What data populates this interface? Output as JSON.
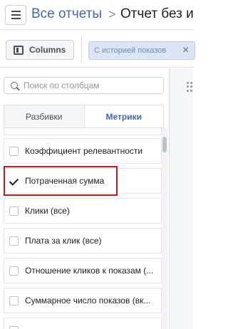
{
  "header": {
    "breadcrumb_link": "Все отчеты",
    "separator": ">",
    "current": "Отчет без и"
  },
  "toolbar": {
    "columns_label": "Columns",
    "filter_chip": "С историей показов",
    "filter_close": "×"
  },
  "panel": {
    "search_placeholder": "Поиск по столбцам",
    "tabs": [
      {
        "label": "Разбивки",
        "active": false
      },
      {
        "label": "Метрики",
        "active": true
      }
    ],
    "items": [
      {
        "label": "",
        "checked": false
      },
      {
        "label": "Коэффициент релевантности",
        "checked": false
      },
      {
        "label": "Потраченная сумма",
        "checked": true,
        "highlighted": true
      },
      {
        "label": "Клики (все)",
        "checked": false
      },
      {
        "label": "Плата за клик (все)",
        "checked": false
      },
      {
        "label": "Отношение кликов к показам (...",
        "checked": false
      },
      {
        "label": "Суммарное число показов (вк...",
        "checked": false
      },
      {
        "label": "",
        "checked": false
      }
    ]
  },
  "colors": {
    "accent": "#4267b2",
    "highlight_border": "#d0141c",
    "chip_bg": "#dce5f4"
  }
}
